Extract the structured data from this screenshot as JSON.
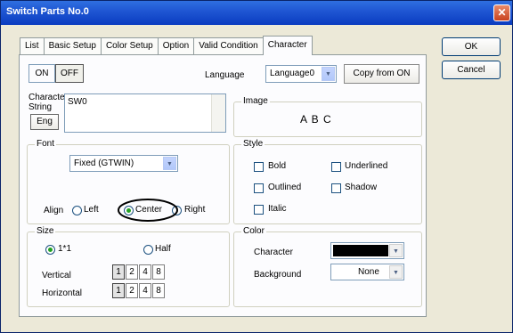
{
  "window": {
    "title": "Switch Parts No.0",
    "close_glyph": "✕"
  },
  "tabs": [
    "List",
    "Basic Setup",
    "Color Setup",
    "Option",
    "Valid Condition",
    "Character"
  ],
  "active_tab": "Character",
  "buttons": {
    "ok": "OK",
    "cancel": "Cancel",
    "on": "ON",
    "off": "OFF",
    "copy_from_on": "Copy from ON",
    "eng": "Eng"
  },
  "language": {
    "label": "Language",
    "value": "Language0"
  },
  "character_string": {
    "label_line1": "Character",
    "label_line2": "String",
    "value": "SW0"
  },
  "image": {
    "label": "Image",
    "preview": "A B C"
  },
  "font": {
    "label": "Font",
    "value": "Fixed (GTWIN)"
  },
  "align": {
    "label": "Align",
    "options": [
      "Left",
      "Center",
      "Right"
    ],
    "selected": "Center"
  },
  "style": {
    "label": "Style",
    "options": [
      "Bold",
      "Underlined",
      "Outlined",
      "Shadow",
      "Italic"
    ]
  },
  "size": {
    "label": "Size",
    "options": [
      "1*1",
      "Half"
    ],
    "selected": "1*1",
    "vertical_label": "Vertical",
    "horizontal_label": "Horizontal",
    "multipliers": [
      "1",
      "2",
      "4",
      "8"
    ],
    "vertical_selected": "1",
    "horizontal_selected": "1"
  },
  "color": {
    "label": "Color",
    "character_label": "Character",
    "character_color": "#000000",
    "background_label": "Background",
    "background_value": "None"
  }
}
